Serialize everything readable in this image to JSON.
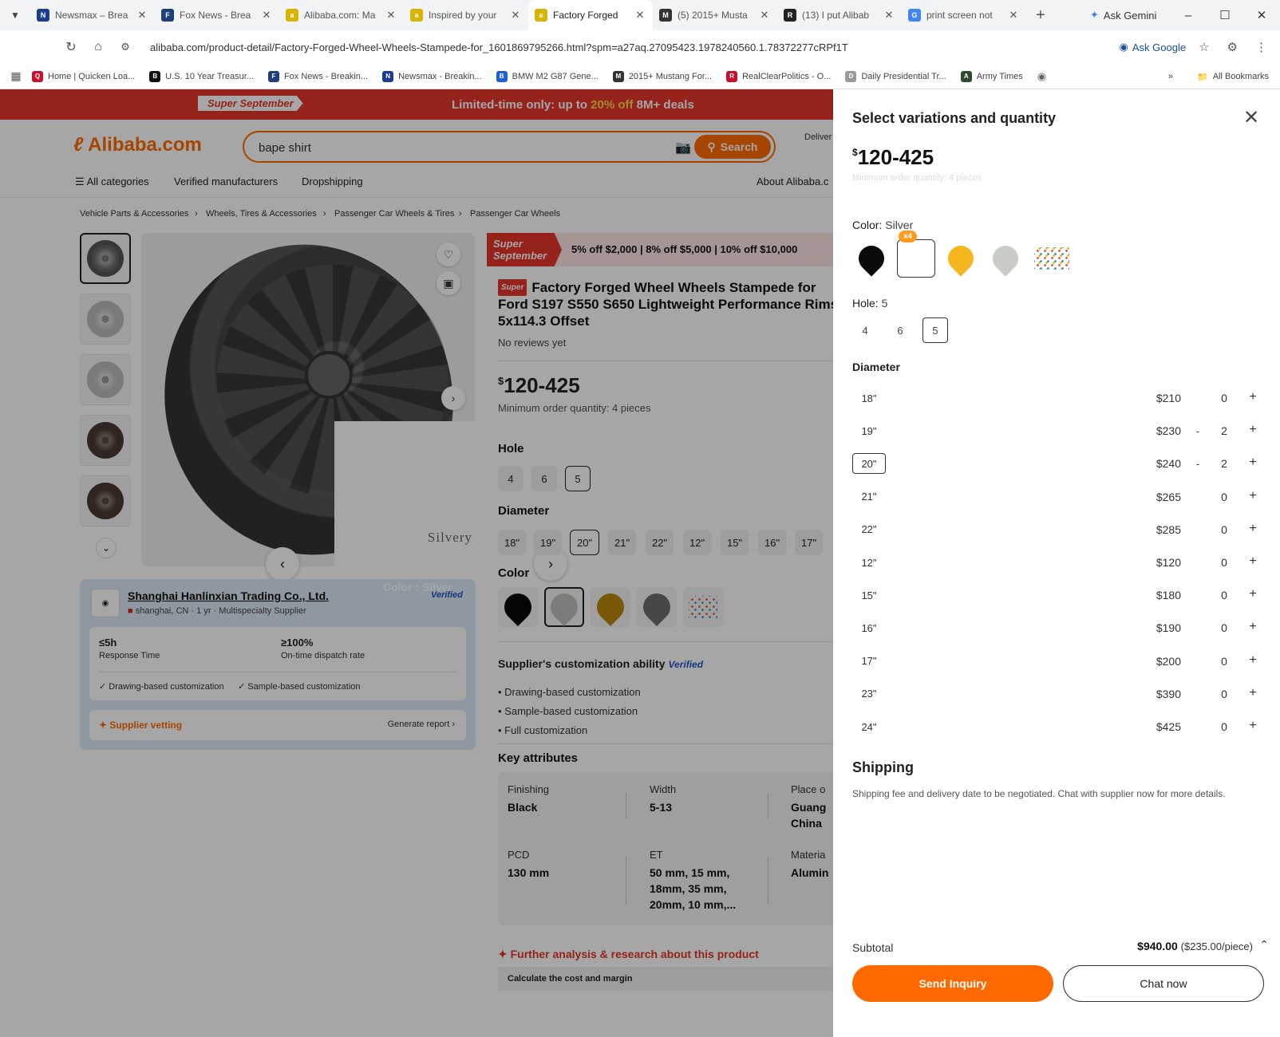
{
  "browser": {
    "tabs": [
      {
        "title": "Newsmax – Brea",
        "fav_text": "N",
        "fav_color": "#1c3e8f"
      },
      {
        "title": "Fox News - Brea",
        "fav_text": "F",
        "fav_color": "#1f3f7a"
      },
      {
        "title": "Alibaba.com: Ma",
        "fav_text": "a",
        "fav_color": "#d7b400"
      },
      {
        "title": "Inspired by your",
        "fav_text": "a",
        "fav_color": "#d7b400"
      },
      {
        "title": "Factory Forged ",
        "fav_text": "a",
        "fav_color": "#d7b400"
      },
      {
        "title": "(5) 2015+ Musta",
        "fav_text": "M",
        "fav_color": "#333333"
      },
      {
        "title": "(13) I put Alibab",
        "fav_text": "R",
        "fav_color": "#222222"
      },
      {
        "title": "print screen not",
        "fav_text": "G",
        "fav_color": "#4285f4"
      }
    ],
    "active_tab": 4,
    "ask_gemini": "Ask Gemini",
    "url": "alibaba.com/product-detail/Factory-Forged-Wheel-Wheels-Stampede-for_1601869795266.html?spm=a27aq.27095423.1978240560.1.78372277cRPf1T",
    "ask_google": "Ask Google",
    "bookmarks": [
      {
        "label": "Home | Quicken Loa...",
        "fav_text": "Q",
        "fav_color": "#c8102e"
      },
      {
        "label": "U.S. 10 Year Treasur...",
        "fav_text": "B",
        "fav_color": "#111111"
      },
      {
        "label": "Fox News - Breakin...",
        "fav_text": "F",
        "fav_color": "#1f3f7a"
      },
      {
        "label": "Newsmax - Breakin...",
        "fav_text": "N",
        "fav_color": "#1c3e8f"
      },
      {
        "label": "BMW M2 G87 Gene...",
        "fav_text": "B",
        "fav_color": "#1c5fd6"
      },
      {
        "label": "2015+ Mustang For...",
        "fav_text": "M",
        "fav_color": "#333333"
      },
      {
        "label": "RealClearPolitics - O...",
        "fav_text": "R",
        "fav_color": "#c8102e"
      },
      {
        "label": "Daily Presidential Tr...",
        "fav_text": "D",
        "fav_color": "#999999"
      },
      {
        "label": "Army Times",
        "fav_text": "A",
        "fav_color": "#2f4a2f"
      }
    ],
    "all_bookmarks": "All Bookmarks"
  },
  "promo": {
    "badge": "Super September",
    "text_pre": "Limited-time only: up to ",
    "text_highlight": "20% off",
    "text_post": " 8M+ deals"
  },
  "header": {
    "logo": "Alibaba.com",
    "search_value": "bape shirt",
    "search_button": "Search",
    "deliver": "Deliver"
  },
  "catnav": [
    "All categories",
    "Verified manufacturers",
    "Dropshipping",
    "About Alibaba.c"
  ],
  "breadcrumbs": [
    "Vehicle Parts & Accessories",
    "Wheels, Tires & Accessories",
    "Passenger Car Wheels & Tires",
    "Passenger Car Wheels"
  ],
  "gallery": {
    "popup_label": "Silvery",
    "color_caption": "Color : Silver"
  },
  "supplier": {
    "name": "Shanghai Hanlinxian Trading Co., Ltd.",
    "meta": "shanghai, CN · 1 yr · Multispecialty Supplier",
    "verified": "Verified",
    "response_value": "≤5h",
    "response_label": "Response Time",
    "dispatch_value": "≥100%",
    "dispatch_label": "On-time dispatch rate",
    "cap1": "Drawing-based customization",
    "cap2": "Sample-based customization",
    "vetting": "Supplier vetting",
    "report": "Generate report"
  },
  "product": {
    "banner_badge": "Super September",
    "banner_text": "5% off $2,000 | 8% off $5,000 | 10% off $10,000",
    "title_badge": "Super",
    "title": "Factory Forged Wheel Wheels Stampede for Ford S197 S550 S650 Lightweight Performance Rims 5x114.3 Offset",
    "reviews": "No reviews yet",
    "price_currency": "$",
    "price": "120-425",
    "moq": "Minimum order quantity: 4 pieces",
    "hole_label": "Hole",
    "holes": [
      "4",
      "6",
      "5"
    ],
    "diameter_label": "Diameter",
    "diameters": [
      "18\"",
      "19\"",
      "20\"",
      "21\"",
      "22\"",
      "12\"",
      "15\"",
      "16\"",
      "17\""
    ],
    "color_label": "Color",
    "customization_title": "Supplier's customization ability",
    "customization_verified": "Verified",
    "customization": [
      "Drawing-based customization",
      "Sample-based customization",
      "Full customization"
    ],
    "key_attributes_title": "Key attributes",
    "key_attributes": [
      {
        "k": "Finishing",
        "v": "Black"
      },
      {
        "k": "Width",
        "v": "5-13"
      },
      {
        "k": "Place o",
        "v": "Guang China"
      },
      {
        "k": "PCD",
        "v": "130 mm"
      },
      {
        "k": "ET",
        "v": "50 mm, 15 mm, 18mm, 35 mm, 20mm, 10 mm,..."
      },
      {
        "k": "Materia",
        "v": "Alumin"
      }
    ],
    "further": "Further analysis & research about this product",
    "calc": "Calculate the cost and margin"
  },
  "drawer": {
    "title": "Select variations and quantity",
    "price_currency": "$",
    "price": "120-425",
    "moq": "Minimum order quantity: 4 pieces",
    "color_label": "Color:",
    "color_value": "Silver",
    "selected_count_badge": "x4",
    "swatch_colors": [
      "#0a0a0a",
      "#ffffff",
      "#f4b71d",
      "#c9cbc6",
      "multi"
    ],
    "hole_label": "Hole:",
    "hole_value": "5",
    "holes": [
      "4",
      "6",
      "5"
    ],
    "diameter_label": "Diameter",
    "diameter_rows": [
      {
        "size": "18\"",
        "price": "$210",
        "qty": "0",
        "minus": ""
      },
      {
        "size": "19\"",
        "price": "$230",
        "qty": "2",
        "minus": "-"
      },
      {
        "size": "20\"",
        "price": "$240",
        "qty": "2",
        "minus": "-"
      },
      {
        "size": "21\"",
        "price": "$265",
        "qty": "0",
        "minus": ""
      },
      {
        "size": "22\"",
        "price": "$285",
        "qty": "0",
        "minus": ""
      },
      {
        "size": "12\"",
        "price": "$120",
        "qty": "0",
        "minus": ""
      },
      {
        "size": "15\"",
        "price": "$180",
        "qty": "0",
        "minus": ""
      },
      {
        "size": "16\"",
        "price": "$190",
        "qty": "0",
        "minus": ""
      },
      {
        "size": "17\"",
        "price": "$200",
        "qty": "0",
        "minus": ""
      },
      {
        "size": "23\"",
        "price": "$390",
        "qty": "0",
        "minus": ""
      },
      {
        "size": "24\"",
        "price": "$425",
        "qty": "0",
        "minus": ""
      }
    ],
    "shipping_title": "Shipping",
    "shipping_text": "Shipping fee and delivery date to be negotiated. Chat with supplier now for more details.",
    "subtotal_label": "Subtotal",
    "subtotal_value": "$940.00",
    "subtotal_each": "($235.00/piece)",
    "send_inquiry": "Send Inquiry",
    "chat_now": "Chat now"
  }
}
